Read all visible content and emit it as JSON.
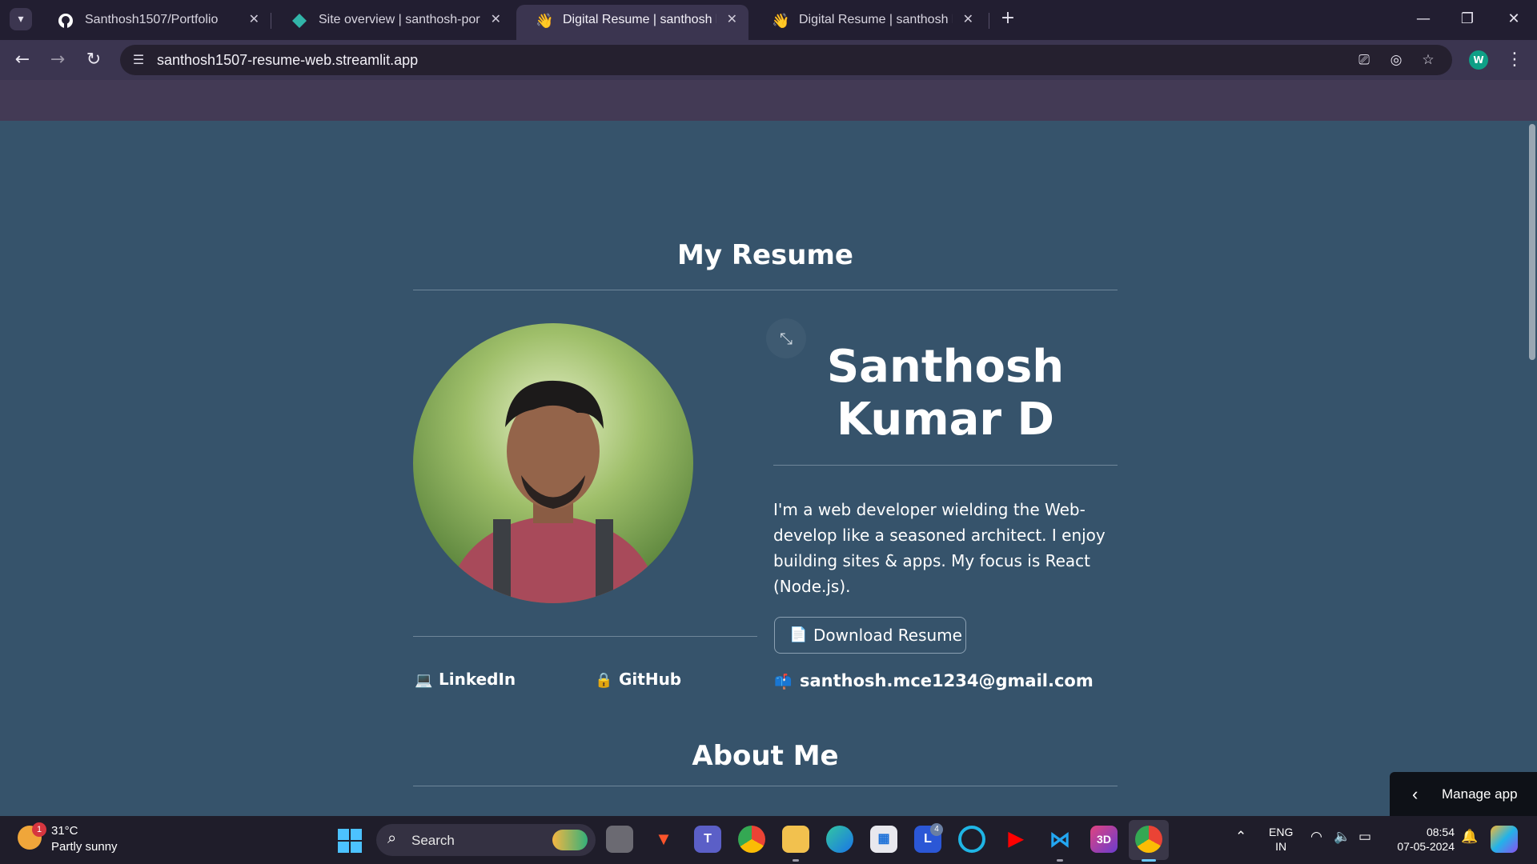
{
  "browser": {
    "tabs": [
      {
        "title": "Santhosh1507/Portfolio",
        "favicon": "github-icon",
        "active": false
      },
      {
        "title": "Site overview | santhosh-portfolio",
        "favicon": "netlify-icon",
        "active": false
      },
      {
        "title": "Digital Resume | santhosh kumar",
        "favicon": "waving-hand-icon",
        "active": true
      },
      {
        "title": "Digital Resume | santhosh kumar",
        "favicon": "waving-hand-icon",
        "active": false
      }
    ],
    "url": "santhosh1507-resume-web.streamlit.app",
    "profile_initial": "W",
    "accent": "#3b3550"
  },
  "page": {
    "resume_heading": "My Resume",
    "name_line1": "Santhosh",
    "name_line2": "Kumar D",
    "bio": "I'm a web developer wielding the Web-develop like a seasoned architect. I enjoy building sites & apps. My focus is React (Node.js).",
    "download_label": "Download Resume",
    "linkedin_label": "LinkedIn",
    "github_label": "GitHub",
    "email": "santhosh.mce1234@gmail.com",
    "about_heading": "About Me",
    "manage_app_label": "Manage app",
    "background_color": "#36536b"
  },
  "taskbar": {
    "weather_temp": "31°C",
    "weather_desc": "Partly sunny",
    "weather_badge": "1",
    "search_label": "Search",
    "app_badge": "4",
    "lang_line1": "ENG",
    "lang_line2": "IN",
    "time": "08:54",
    "date": "07-05-2024"
  }
}
